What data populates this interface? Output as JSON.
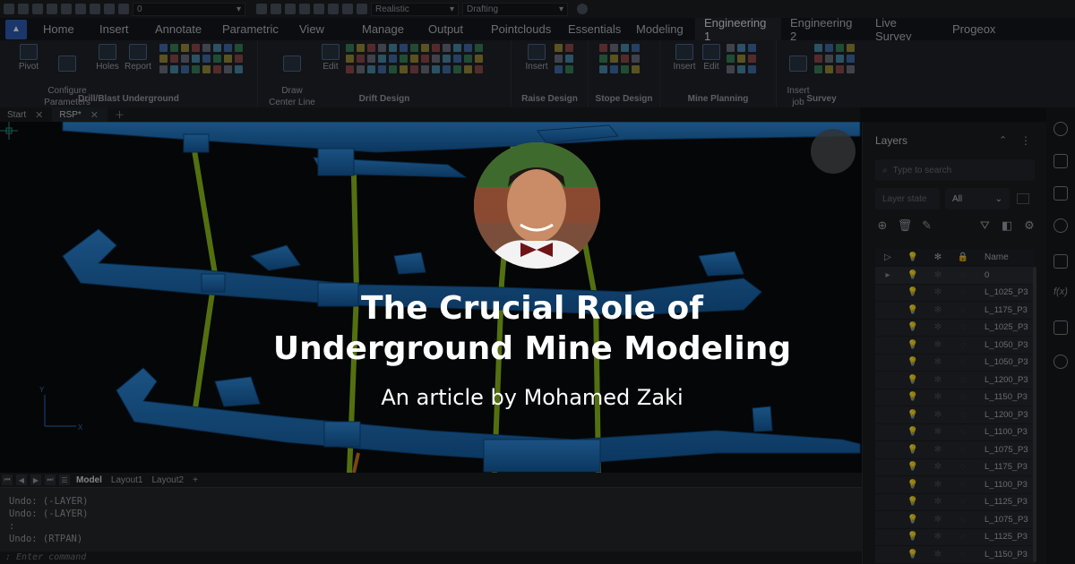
{
  "quick_toolbar": {
    "layer_value": "0",
    "visual_style": "Realistic",
    "workspace": "Drafting"
  },
  "ribbon_tabs": [
    {
      "label": "Home"
    },
    {
      "label": "Insert"
    },
    {
      "label": "Annotate"
    },
    {
      "label": "Parametric"
    },
    {
      "label": "View"
    },
    {
      "label": "Manage"
    },
    {
      "label": "Output"
    },
    {
      "label": "Pointclouds"
    },
    {
      "label": "Essentials"
    },
    {
      "label": "Modeling"
    },
    {
      "label": "Engineering 1",
      "active": true
    },
    {
      "label": "Engineering 2"
    },
    {
      "label": "Live Survey"
    },
    {
      "label": "Progeox"
    }
  ],
  "ribbon_groups": {
    "drill_blast": {
      "label": "Drill/Blast Underground",
      "pivot": "Pivot",
      "configure": "Configure\nParameters",
      "holes": "Holes",
      "report": "Report"
    },
    "drift": {
      "label": "Drift Design",
      "draw_center_line": "Draw\nCenter Line",
      "edit": "Edit"
    },
    "raise": {
      "label": "Raise Design",
      "insert": "Insert"
    },
    "stope": {
      "label": "Stope Design"
    },
    "mine_planning": {
      "label": "Mine Planning",
      "insert": "Insert",
      "edit": "Edit"
    },
    "survey": {
      "label": "Survey",
      "insert_job": "Insert\njob"
    }
  },
  "doc_tabs": [
    {
      "label": "Start"
    },
    {
      "label": "RSP*",
      "active": true
    }
  ],
  "layout_tabs": [
    {
      "label": "Model",
      "active": true
    },
    {
      "label": "Layout1"
    },
    {
      "label": "Layout2"
    }
  ],
  "command_history": "Undo: (-LAYER)\nUndo: (-LAYER)\n:\nUndo: (RTPAN)",
  "command_prompt": ": Enter command",
  "layers_panel": {
    "title": "Layers",
    "search_placeholder": "Type to search",
    "layer_state_placeholder": "Layer state",
    "filter_value": "All",
    "name_header": "Name",
    "rows": [
      {
        "name": "0",
        "selected": true
      },
      {
        "name": "L_1025_P3"
      },
      {
        "name": "L_1175_P3"
      },
      {
        "name": "L_1025_P3"
      },
      {
        "name": "L_1050_P3"
      },
      {
        "name": "L_1050_P3"
      },
      {
        "name": "L_1200_P3"
      },
      {
        "name": "L_1150_P3"
      },
      {
        "name": "L_1200_P3"
      },
      {
        "name": "L_1100_P3"
      },
      {
        "name": "L_1075_P3"
      },
      {
        "name": "L_1175_P3"
      },
      {
        "name": "L_1100_P3"
      },
      {
        "name": "L_1125_P3"
      },
      {
        "name": "L_1075_P3"
      },
      {
        "name": "L_1125_P3"
      },
      {
        "name": "L_1150_P3"
      }
    ]
  },
  "axis_labels": {
    "y": "Y",
    "x": "X"
  },
  "article": {
    "title_line1": "The Crucial Role of",
    "title_line2": "Underground Mine Modeling",
    "byline": "An article by Mohamed Zaki"
  },
  "colors": {
    "drift_blue": "#1f78c8",
    "raise_green": "#8fc21c",
    "accent": "#2d5fb8"
  }
}
